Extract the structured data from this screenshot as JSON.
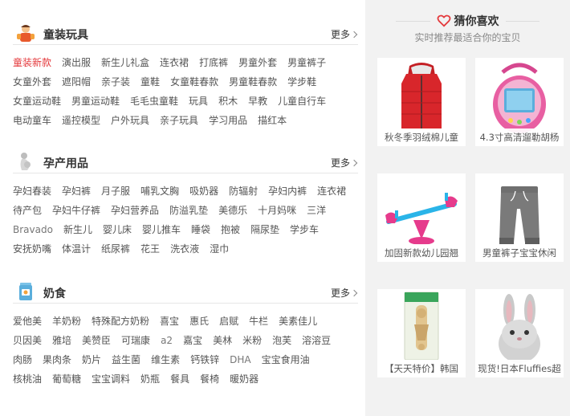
{
  "sections": [
    {
      "title": "童装玩具",
      "more": "更多",
      "links": [
        "童装新款",
        "演出服",
        "新生儿礼盒",
        "连衣裙",
        "打底裤",
        "男童外套",
        "男童裤子",
        "女童外套",
        "遮阳帽",
        "亲子装",
        "童鞋",
        "女童鞋春款",
        "男童鞋春款",
        "学步鞋",
        "女童运动鞋",
        "男童运动鞋",
        "毛毛虫童鞋",
        "玩具",
        "积木",
        "早教",
        "儿童自行车",
        "电动童车",
        "遥控模型",
        "户外玩具",
        "亲子玩具",
        "学习用品",
        "描红本"
      ],
      "hot_index": 0
    },
    {
      "title": "孕产用品",
      "more": "更多",
      "links": [
        "孕妇春装",
        "孕妇裤",
        "月子服",
        "哺乳文胸",
        "吸奶器",
        "防辐射",
        "孕妇内裤",
        "连衣裙",
        "待产包",
        "孕妇牛仔裤",
        "孕妇营养品",
        "防溢乳垫",
        "美德乐",
        "十月妈咪",
        "三洋",
        "Bravado",
        "新生儿",
        "婴儿床",
        "婴儿推车",
        "睡袋",
        "抱被",
        "隔尿垫",
        "学步车",
        "安抚奶嘴",
        "体温计",
        "纸尿裤",
        "花王",
        "洗衣液",
        "湿巾"
      ]
    },
    {
      "title": "奶食",
      "more": "更多",
      "links": [
        "爱他美",
        "羊奶粉",
        "特殊配方奶粉",
        "喜宝",
        "惠氏",
        "启赋",
        "牛栏",
        "美素佳儿",
        "贝因美",
        "雅培",
        "美赞臣",
        "可瑞康",
        "a2",
        "嘉宝",
        "美林",
        "米粉",
        "泡芙",
        "溶溶豆",
        "肉肠",
        "果肉条",
        "奶片",
        "益生菌",
        "维生素",
        "钙铁锌",
        "DHA",
        "宝宝食用油",
        "核桃油",
        "葡萄糖",
        "宝宝调料",
        "奶瓶",
        "餐具",
        "餐椅",
        "暖奶器"
      ]
    }
  ],
  "guess": {
    "title": "猜你喜欢",
    "subtitle": "实时推荐最适合你的宝贝",
    "products": [
      {
        "caption": "秋冬季羽绒棉儿童"
      },
      {
        "caption": "4.3寸高清遛勒胡杨"
      },
      {
        "caption": "加固新款幼儿园翘"
      },
      {
        "caption": "男童裤子宝宝休闲"
      },
      {
        "caption": "【天天特价】韩国"
      },
      {
        "caption": "现货!日本Fluffies超"
      }
    ]
  },
  "colors": {
    "hot": "#e4393c",
    "panel": "#f2f2f2",
    "heart": "#e4393c"
  }
}
